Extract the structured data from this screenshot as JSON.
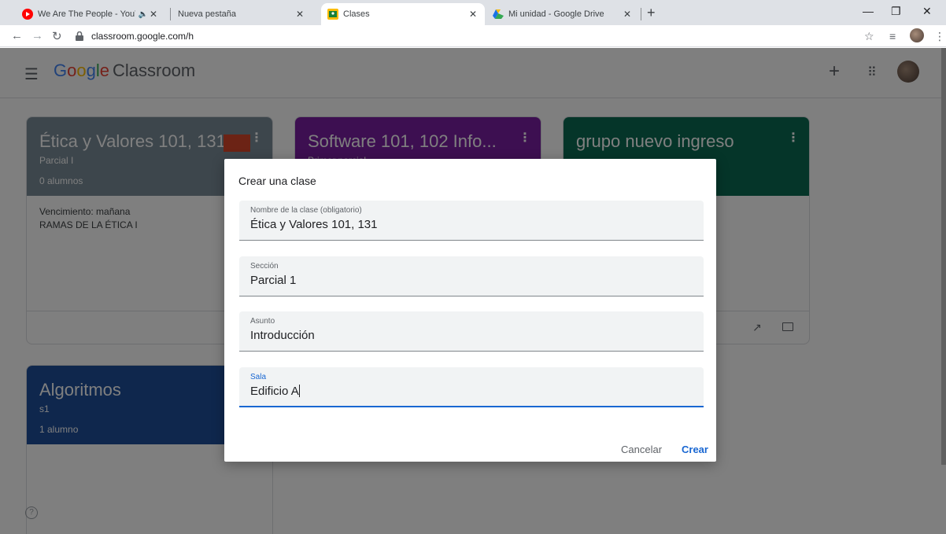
{
  "browser": {
    "tabs": [
      {
        "title": "We Are The People - YouTube",
        "favicon": "youtube-icon",
        "color": "#ff0000"
      },
      {
        "title": "Nueva pestaña",
        "favicon": "none",
        "color": ""
      },
      {
        "title": "Clases",
        "favicon": "classroom-icon",
        "color": "#fbbc05"
      },
      {
        "title": "Mi unidad - Google Drive",
        "favicon": "drive-icon",
        "color": "#34a853"
      }
    ],
    "url": "classroom.google.com/h"
  },
  "app": {
    "logo_google": [
      "G",
      "o",
      "o",
      "g",
      "l",
      "e"
    ],
    "product_name": "Classroom"
  },
  "classes": [
    {
      "title": "Ética y Valores 101, 131",
      "section": "Parcial I",
      "students": "0 alumnos",
      "color": "#7b8c98",
      "due": "Vencimiento: mañana",
      "assignment": "RAMAS DE LA ÉTICA I"
    },
    {
      "title": "Software 101, 102 Info...",
      "section": "Primer parcial",
      "students": "",
      "color": "#7b1fa2",
      "due": "",
      "assignment": ""
    },
    {
      "title": "grupo nuevo ingreso",
      "section": "",
      "students": "",
      "color": "#0a6b53",
      "due": "",
      "assignment": ""
    },
    {
      "title": "Algoritmos",
      "section": "s1",
      "students": "1 alumno",
      "color": "#1e4e9a",
      "due": "",
      "assignment": ""
    }
  ],
  "dialog": {
    "title": "Crear una clase",
    "fields": [
      {
        "label": "Nombre de la clase (obligatorio)",
        "value": "Ética y Valores 101, 131"
      },
      {
        "label": "Sección",
        "value": "Parcial 1"
      },
      {
        "label": "Asunto",
        "value": "Introducción"
      },
      {
        "label": "Sala",
        "value": "Edificio A"
      }
    ],
    "cancel_label": "Cancelar",
    "create_label": "Crear"
  }
}
